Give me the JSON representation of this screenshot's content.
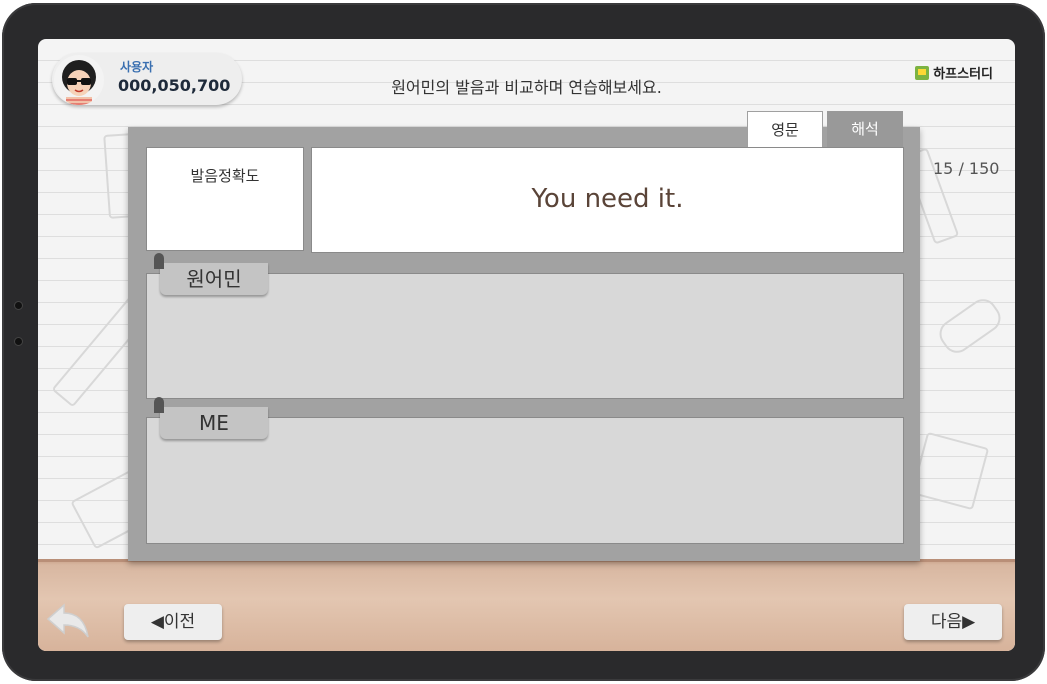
{
  "user": {
    "label": "사용자",
    "score": "000,050,700"
  },
  "instruction": "원어민의 발음과 비교하며 연습해보세요.",
  "brand": {
    "name": "하프스터디",
    "icon": "book-icon"
  },
  "page_counter": "15 / 150",
  "tabs": [
    {
      "label": "영문",
      "active": true
    },
    {
      "label": "해석",
      "active": false
    }
  ],
  "accuracy": {
    "label": "발음정확도"
  },
  "sentence": "You need it.",
  "native": {
    "label": "원어민"
  },
  "me": {
    "label": "ME"
  },
  "nav": {
    "prev": "◀이전",
    "next": "다음▶",
    "back_icon": "return-arrow-icon"
  },
  "colors": {
    "accent_tab": "#999999",
    "panel": "#a2a2a2",
    "floor": "#d8b7a1",
    "label_blue": "#3a6fb0"
  }
}
